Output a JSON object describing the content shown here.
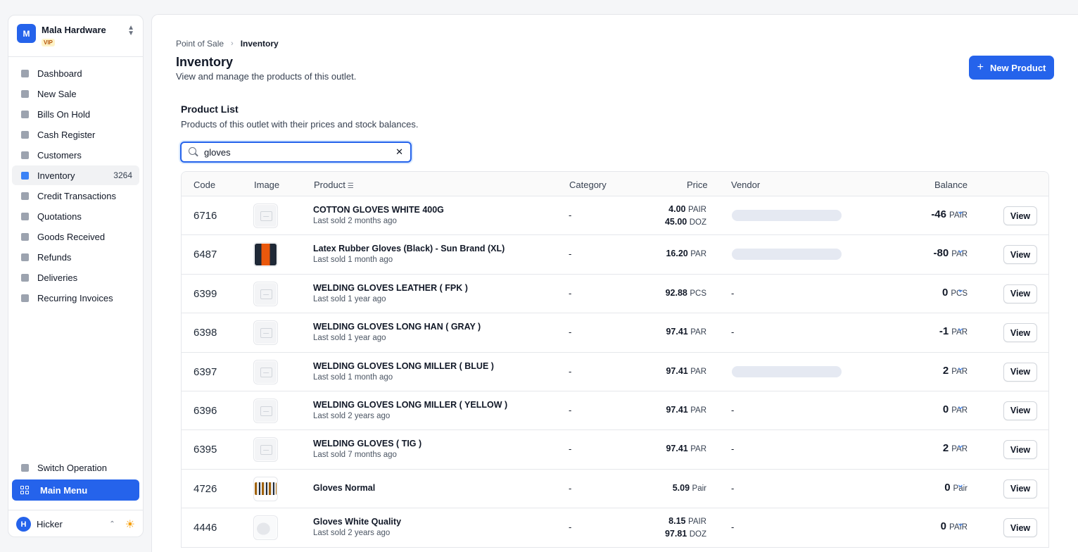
{
  "org": {
    "avatar_letter": "M",
    "name": "Mala Hardware",
    "badge": "VIP"
  },
  "nav": {
    "items": [
      {
        "label": "Dashboard",
        "icon": "dashboard-icon"
      },
      {
        "label": "New Sale",
        "icon": "new-sale-icon"
      },
      {
        "label": "Bills On Hold",
        "icon": "bills-on-hold-icon"
      },
      {
        "label": "Cash Register",
        "icon": "cash-register-icon"
      },
      {
        "label": "Customers",
        "icon": "customers-icon"
      },
      {
        "label": "Inventory",
        "icon": "inventory-icon",
        "count": "3264",
        "active": true
      },
      {
        "label": "Credit Transactions",
        "icon": "credit-transactions-icon"
      },
      {
        "label": "Quotations",
        "icon": "quotations-icon"
      },
      {
        "label": "Goods Received",
        "icon": "goods-received-icon"
      },
      {
        "label": "Refunds",
        "icon": "refunds-icon"
      },
      {
        "label": "Deliveries",
        "icon": "deliveries-icon"
      },
      {
        "label": "Recurring Invoices",
        "icon": "recurring-invoices-icon"
      }
    ],
    "switch_operation": "Switch Operation",
    "main_menu": "Main Menu"
  },
  "user": {
    "avatar_letter": "H",
    "name": "Hicker"
  },
  "breadcrumb": {
    "root": "Point of Sale",
    "current": "Inventory"
  },
  "page": {
    "title": "Inventory",
    "subtitle": "View and manage the products of this outlet.",
    "new_button": "New Product"
  },
  "section": {
    "title": "Product List",
    "subtitle": "Products of this outlet with their prices and stock balances."
  },
  "search": {
    "value": "gloves"
  },
  "table": {
    "headers": {
      "code": "Code",
      "image": "Image",
      "product": "Product",
      "category": "Category",
      "price": "Price",
      "vendor": "Vendor",
      "balance": "Balance"
    },
    "view_label": "View",
    "rows": [
      {
        "code": "6716",
        "image": "placeholder",
        "name": "COTTON GLOVES WHITE 400G",
        "sub": "Last sold 2 months ago",
        "category": "-",
        "prices": [
          {
            "amount": "4.00",
            "unit": "PAIR"
          },
          {
            "amount": "45.00",
            "unit": "DOZ"
          }
        ],
        "vendor": "",
        "vendor_redacted": true,
        "balance": "-46",
        "balance_unit": "PAIR"
      },
      {
        "code": "6487",
        "image": "gloves-black",
        "name": "Latex Rubber Gloves (Black) - Sun Brand (XL)",
        "sub": "Last sold 1 month ago",
        "category": "-",
        "prices": [
          {
            "amount": "16.20",
            "unit": "PAR"
          }
        ],
        "vendor": "",
        "vendor_redacted": true,
        "balance": "-80",
        "balance_unit": "PAR"
      },
      {
        "code": "6399",
        "image": "placeholder",
        "name": "WELDING GLOVES LEATHER ( FPK )",
        "sub": "Last sold 1 year ago",
        "category": "-",
        "prices": [
          {
            "amount": "92.88",
            "unit": "PCS"
          }
        ],
        "vendor": "-",
        "vendor_redacted": false,
        "balance": "0",
        "balance_unit": "PCS"
      },
      {
        "code": "6398",
        "image": "placeholder",
        "name": "WELDING GLOVES LONG HAN ( GRAY )",
        "sub": "Last sold 1 year ago",
        "category": "-",
        "prices": [
          {
            "amount": "97.41",
            "unit": "PAR"
          }
        ],
        "vendor": "-",
        "vendor_redacted": false,
        "balance": "-1",
        "balance_unit": "PAR"
      },
      {
        "code": "6397",
        "image": "placeholder",
        "name": "WELDING GLOVES LONG MILLER ( BLUE )",
        "sub": "Last sold 1 month ago",
        "category": "-",
        "prices": [
          {
            "amount": "97.41",
            "unit": "PAR"
          }
        ],
        "vendor": "",
        "vendor_redacted": true,
        "balance": "2",
        "balance_unit": "PAR"
      },
      {
        "code": "6396",
        "image": "placeholder",
        "name": "WELDING GLOVES LONG MILLER ( YELLOW )",
        "sub": "Last sold 2 years ago",
        "category": "-",
        "prices": [
          {
            "amount": "97.41",
            "unit": "PAR"
          }
        ],
        "vendor": "-",
        "vendor_redacted": false,
        "balance": "0",
        "balance_unit": "PAR"
      },
      {
        "code": "6395",
        "image": "placeholder",
        "name": "WELDING GLOVES ( TIG )",
        "sub": "Last sold 7 months ago",
        "category": "-",
        "prices": [
          {
            "amount": "97.41",
            "unit": "PAR"
          }
        ],
        "vendor": "-",
        "vendor_redacted": false,
        "balance": "2",
        "balance_unit": "PAR"
      },
      {
        "code": "4726",
        "image": "gloves-normal",
        "name": "Gloves Normal",
        "sub": "",
        "category": "-",
        "prices": [
          {
            "amount": "5.09",
            "unit": "Pair"
          }
        ],
        "vendor": "-",
        "vendor_redacted": false,
        "balance": "0",
        "balance_unit": "Pair"
      },
      {
        "code": "4446",
        "image": "gloves-white",
        "name": "Gloves White Quality",
        "sub": "Last sold 2 years ago",
        "category": "-",
        "prices": [
          {
            "amount": "8.15",
            "unit": "PAIR"
          },
          {
            "amount": "97.81",
            "unit": "DOZ"
          }
        ],
        "vendor": "-",
        "vendor_redacted": false,
        "balance": "0",
        "balance_unit": "PAIR"
      }
    ]
  },
  "colors": {
    "accent": "#2563eb",
    "vip_text": "#b45309",
    "sun": "#f59e0b"
  }
}
